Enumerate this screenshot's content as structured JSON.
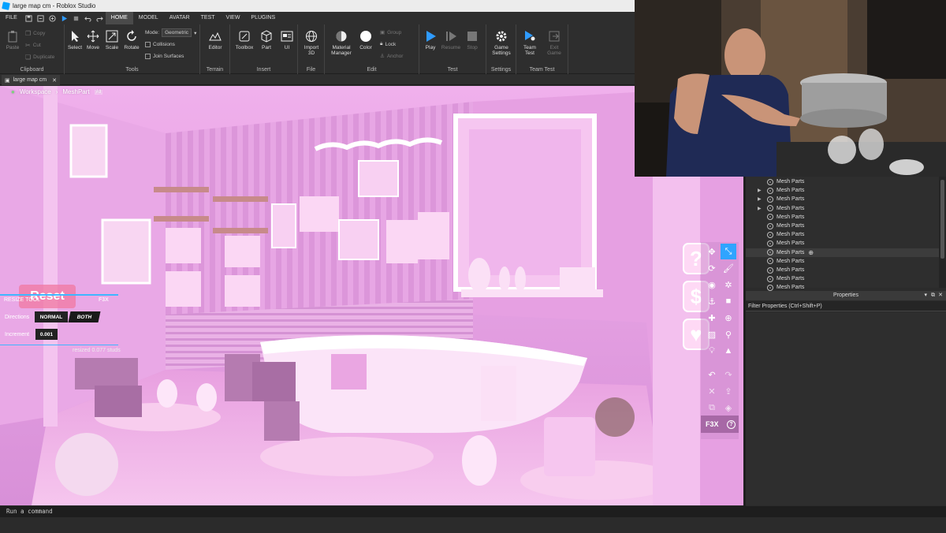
{
  "window": {
    "title": "large map cm - Roblox Studio"
  },
  "menu": {
    "file": "FILE",
    "tabs": [
      "HOME",
      "MODEL",
      "AVATAR",
      "TEST",
      "VIEW",
      "PLUGINS"
    ],
    "active_tab": "HOME"
  },
  "ribbon": {
    "clipboard": {
      "label": "Clipboard",
      "paste": "Paste",
      "copy": "Copy",
      "cut": "Cut",
      "duplicate": "Duplicate"
    },
    "tools": {
      "label": "Tools",
      "select": "Select",
      "move": "Move",
      "scale": "Scale",
      "rotate": "Rotate",
      "mode_label": "Mode:",
      "mode_value": "Geometric",
      "collisions": "Collisions",
      "join_surfaces": "Join Surfaces"
    },
    "terrain": {
      "label": "Terrain",
      "editor": "Editor"
    },
    "insert": {
      "label": "Insert",
      "toolbox": "Toolbox",
      "part": "Part",
      "ui": "UI"
    },
    "file": {
      "label": "File",
      "import": "Import",
      "import2": "3D"
    },
    "edit": {
      "label": "Edit",
      "material": "Material",
      "material2": "Manager",
      "color": "Color",
      "group": "Group",
      "lock": "Lock",
      "anchor": "Anchor"
    },
    "test": {
      "label": "Test",
      "play": "Play",
      "resume": "Resume",
      "stop": "Stop"
    },
    "settings": {
      "label": "Settings",
      "game": "Game",
      "game2": "Settings"
    },
    "team_test": {
      "label": "Team Test",
      "team": "Team",
      "team2": "Test",
      "exit": "Exit",
      "exit2": "Game"
    }
  },
  "document_tab": {
    "label": "large map cm"
  },
  "viewport": {
    "breadcrumb": [
      "Workspace",
      "MeshPart",
      "All"
    ],
    "hud": {
      "reset": "Reset",
      "tool_title": "RESIZE TOOL",
      "f3x": "F3X",
      "directions_label": "Directions",
      "dir_normal": "NORMAL",
      "dir_both": "BOTH",
      "increment_label": "Increment",
      "increment_value": "0.001",
      "status": "resized 0.077 studs"
    },
    "f3x_buttons": [
      "?",
      "$",
      "♥"
    ],
    "f3x_logo": "F3X",
    "f3x_help": "?",
    "f3x_hotkeys": [
      "Z",
      "X",
      "C",
      "V",
      "B",
      "N",
      "J",
      "M",
      "K",
      "G",
      "F",
      "U",
      "P",
      "R",
      "L"
    ]
  },
  "explorer": {
    "items": [
      "Mesh Parts",
      "Mesh Parts",
      "Mesh Parts",
      "Mesh Parts",
      "Mesh Parts",
      "Mesh Parts",
      "Mesh Parts",
      "Mesh Parts",
      "Mesh Parts",
      "Mesh Parts",
      "Mesh Parts",
      "Mesh Parts",
      "Mesh Parts"
    ]
  },
  "properties": {
    "title": "Properties",
    "filter_placeholder": "Filter Properties (Ctrl+Shift+P)"
  },
  "command_bar": {
    "placeholder": "Run a command"
  },
  "colors": {
    "accent_blue": "#00a2ff",
    "pink_scene": "#e6a3e6",
    "studio_bg": "#2e2e2e"
  }
}
